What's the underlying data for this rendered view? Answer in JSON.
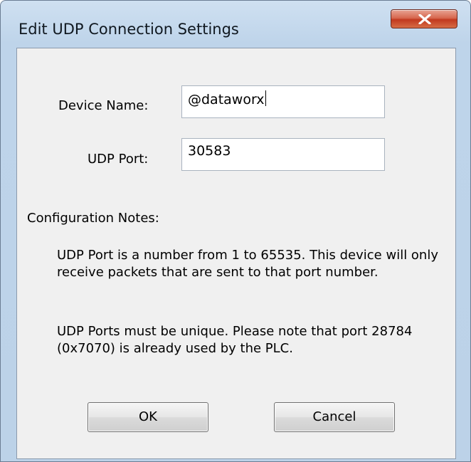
{
  "window": {
    "title": "Edit UDP Connection Settings",
    "close_icon": "close-icon"
  },
  "form": {
    "device_name_label": "Device Name:",
    "device_name_value": "@dataworx",
    "udp_port_label": "UDP Port:",
    "udp_port_value": "30583"
  },
  "notes": {
    "header": "Configuration Notes:",
    "note1": "UDP Port is a number from 1 to 65535. This device will only receive packets that are sent to that port number.",
    "note2": "UDP Ports must be unique. Please note that port 28784 (0x7070) is already used by the PLC."
  },
  "buttons": {
    "ok": "OK",
    "cancel": "Cancel"
  },
  "colors": {
    "close_button": "#c2391f",
    "frame": "#bcd2e8",
    "panel": "#f0f0f0"
  }
}
